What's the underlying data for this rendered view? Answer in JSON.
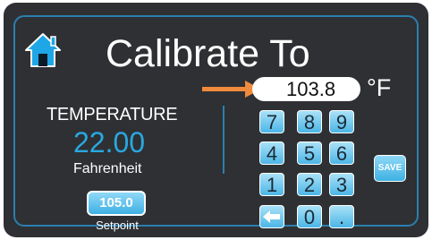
{
  "header": {
    "title": "Calibrate To",
    "home_icon": "home-icon"
  },
  "entry": {
    "value": "103.8",
    "unit": "°F",
    "arrow_color": "#f08a3c"
  },
  "reading": {
    "label": "TEMPERATURE",
    "value": "22.00",
    "unit": "Fahrenheit"
  },
  "setpoint": {
    "value": "105.0",
    "label": "Setpoint"
  },
  "keypad": {
    "k7": "7",
    "k8": "8",
    "k9": "9",
    "k4": "4",
    "k5": "5",
    "k6": "6",
    "k1": "1",
    "k2": "2",
    "k3": "3",
    "k0": "0",
    "kdot": ".",
    "backspace_icon": "backspace-arrow-icon"
  },
  "actions": {
    "save_label": "SAVE"
  },
  "colors": {
    "accent": "#29a8e0",
    "frame": "#2b7fb0",
    "background": "#2e3033"
  }
}
